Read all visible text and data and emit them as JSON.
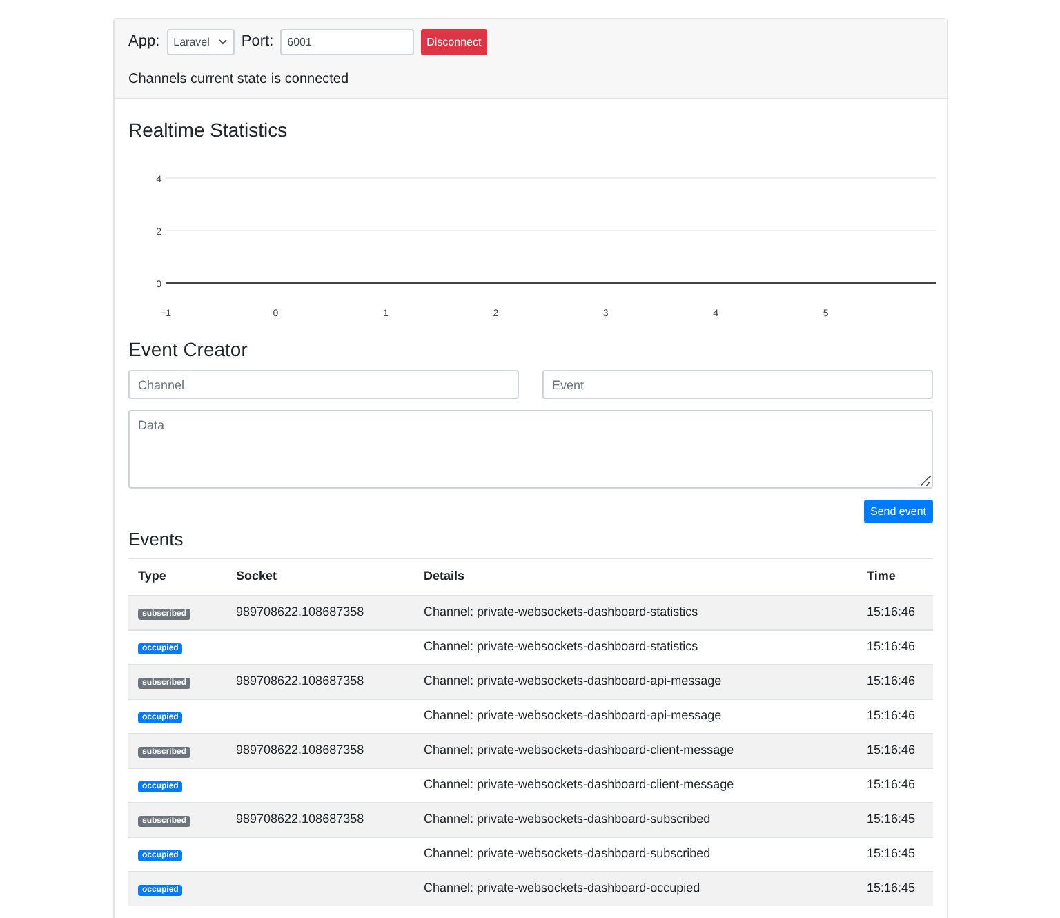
{
  "connection": {
    "app_label": "App:",
    "app_value": "Laravel",
    "port_label": "Port:",
    "port_value": "6001",
    "disconnect_button": "Disconnect",
    "state_text": "Channels current state is connected"
  },
  "statistics": {
    "title": "Realtime Statistics",
    "chart_data": {
      "type": "line",
      "xlim": [
        -1,
        6
      ],
      "ylim": [
        0,
        4
      ],
      "xticks": [
        -1,
        0,
        1,
        2,
        3,
        4,
        5
      ],
      "yticks": [
        0,
        2,
        4
      ]
    }
  },
  "event_creator": {
    "title": "Event Creator",
    "channel_placeholder": "Channel",
    "event_placeholder": "Event",
    "data_placeholder": "Data",
    "send_button": "Send event"
  },
  "events": {
    "title": "Events",
    "columns": [
      "Type",
      "Socket",
      "Details",
      "Time"
    ],
    "rows": [
      {
        "type": "subscribed",
        "kind": "subscribed",
        "socket": "989708622.108687358",
        "details": "Channel: private-websockets-dashboard-statistics",
        "time": "15:16:46"
      },
      {
        "type": "occupied",
        "kind": "occupied",
        "details": "Channel: private-websockets-dashboard-statistics",
        "time": "15:16:46"
      },
      {
        "type": "subscribed",
        "kind": "subscribed",
        "socket": "989708622.108687358",
        "details": "Channel: private-websockets-dashboard-api-message",
        "time": "15:16:46"
      },
      {
        "type": "occupied",
        "kind": "occupied",
        "details": "Channel: private-websockets-dashboard-api-message",
        "time": "15:16:46"
      },
      {
        "type": "subscribed",
        "kind": "subscribed",
        "socket": "989708622.108687358",
        "details": "Channel: private-websockets-dashboard-client-message",
        "time": "15:16:46"
      },
      {
        "type": "occupied",
        "kind": "occupied",
        "details": "Channel: private-websockets-dashboard-client-message",
        "time": "15:16:46"
      },
      {
        "type": "subscribed",
        "kind": "subscribed",
        "socket": "989708622.108687358",
        "details": "Channel: private-websockets-dashboard-subscribed",
        "time": "15:16:45"
      },
      {
        "type": "occupied",
        "kind": "occupied",
        "details": "Channel: private-websockets-dashboard-subscribed",
        "time": "15:16:45"
      },
      {
        "type": "occupied",
        "kind": "occupied",
        "details": "Channel: private-websockets-dashboard-occupied",
        "time": "15:16:45"
      }
    ]
  }
}
